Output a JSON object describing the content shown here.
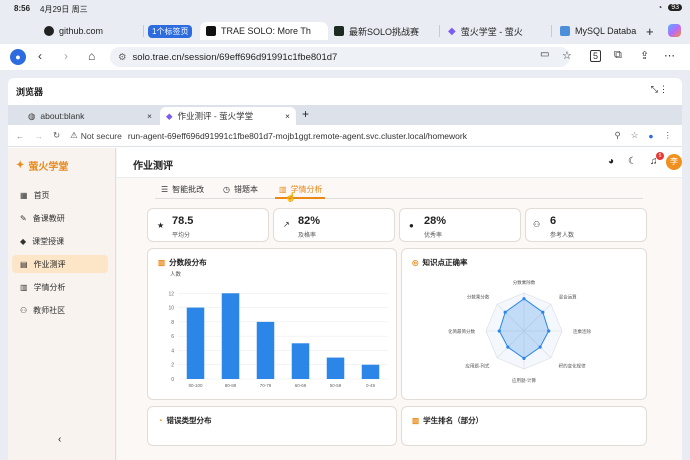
{
  "status": {
    "time": "8:56",
    "date": "4月29日 周三",
    "battery": "93"
  },
  "outer_tabs": [
    {
      "label": "github.com"
    },
    {
      "label": "1个标签页"
    },
    {
      "label": "TRAE SOLO: More Th"
    },
    {
      "label": "最新SOLO挑战赛"
    },
    {
      "label": "萤火学堂 - 萤火"
    },
    {
      "label": "MySQL Databa"
    }
  ],
  "outer_url": "solo.trae.cn/session/69eff696d91991c1fbe801d7",
  "browser_title": "浏览器",
  "inner_tabs": [
    {
      "label": "about:blank"
    },
    {
      "label": "作业测评 - 萤火学堂"
    }
  ],
  "inner_url": {
    "secure": "Not secure",
    "url": "run-agent-69eff696d91991c1fbe801d7-mojb1ggt.remote-agent.svc.cluster.local/homework"
  },
  "app": {
    "logo": "萤火学堂",
    "nav": [
      {
        "label": "首页"
      },
      {
        "label": "备课教研"
      },
      {
        "label": "课堂授课"
      },
      {
        "label": "作业测评"
      },
      {
        "label": "学情分析"
      },
      {
        "label": "教师社区"
      }
    ],
    "page_title": "作业测评",
    "avatar": "李",
    "notif_count": "5",
    "tabs": [
      {
        "label": "智能批改"
      },
      {
        "label": "错题本"
      },
      {
        "label": "学情分析"
      }
    ],
    "stats": [
      {
        "value": "78.5",
        "label": "平均分"
      },
      {
        "value": "82%",
        "label": "及格率"
      },
      {
        "value": "28%",
        "label": "优秀率"
      },
      {
        "value": "6",
        "label": "参考人数"
      }
    ],
    "panels": {
      "score": "分数段分布",
      "knowledge": "知识点正确率",
      "errors": "错误类型分布",
      "ranking": "学生排名（部分）"
    }
  },
  "chart_data": [
    {
      "type": "bar",
      "title": "分数段分布",
      "ylabel": "人数",
      "categories": [
        "90-100",
        "80-89",
        "70-79",
        "60-69",
        "50-59",
        "0-49"
      ],
      "values": [
        10,
        12,
        8,
        5,
        3,
        2
      ],
      "ylim": [
        0,
        14
      ],
      "yticks": [
        0,
        2,
        4,
        6,
        8,
        10,
        12
      ],
      "grid": true
    },
    {
      "type": "radar",
      "title": "知识点正确率",
      "categories": [
        "分数乘除数",
        "混合运算",
        "连乘连除",
        "积的变化规律",
        "应用题-计算",
        "应用题-列式",
        "化简最简分数",
        "分数乘分数"
      ],
      "values": [
        0.85,
        0.7,
        0.65,
        0.6,
        0.72,
        0.6,
        0.65,
        0.7
      ],
      "range": [
        0,
        1
      ]
    }
  ]
}
